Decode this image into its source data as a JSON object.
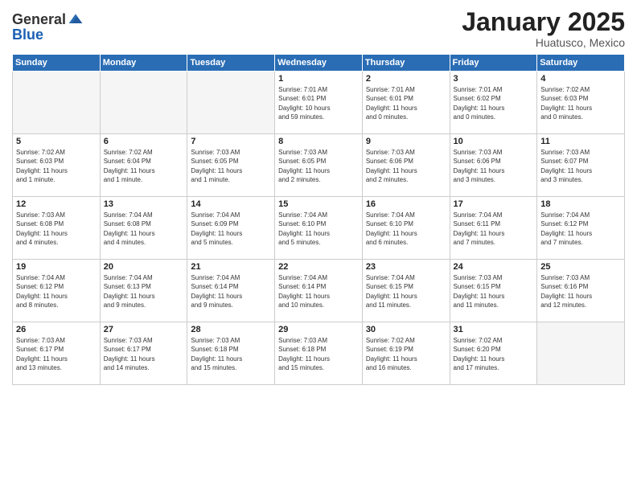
{
  "header": {
    "logo_general": "General",
    "logo_blue": "Blue",
    "title": "January 2025",
    "location": "Huatusco, Mexico"
  },
  "days_of_week": [
    "Sunday",
    "Monday",
    "Tuesday",
    "Wednesday",
    "Thursday",
    "Friday",
    "Saturday"
  ],
  "weeks": [
    [
      {
        "day": "",
        "info": ""
      },
      {
        "day": "",
        "info": ""
      },
      {
        "day": "",
        "info": ""
      },
      {
        "day": "1",
        "info": "Sunrise: 7:01 AM\nSunset: 6:01 PM\nDaylight: 10 hours\nand 59 minutes."
      },
      {
        "day": "2",
        "info": "Sunrise: 7:01 AM\nSunset: 6:01 PM\nDaylight: 11 hours\nand 0 minutes."
      },
      {
        "day": "3",
        "info": "Sunrise: 7:01 AM\nSunset: 6:02 PM\nDaylight: 11 hours\nand 0 minutes."
      },
      {
        "day": "4",
        "info": "Sunrise: 7:02 AM\nSunset: 6:03 PM\nDaylight: 11 hours\nand 0 minutes."
      }
    ],
    [
      {
        "day": "5",
        "info": "Sunrise: 7:02 AM\nSunset: 6:03 PM\nDaylight: 11 hours\nand 1 minute."
      },
      {
        "day": "6",
        "info": "Sunrise: 7:02 AM\nSunset: 6:04 PM\nDaylight: 11 hours\nand 1 minute."
      },
      {
        "day": "7",
        "info": "Sunrise: 7:03 AM\nSunset: 6:05 PM\nDaylight: 11 hours\nand 1 minute."
      },
      {
        "day": "8",
        "info": "Sunrise: 7:03 AM\nSunset: 6:05 PM\nDaylight: 11 hours\nand 2 minutes."
      },
      {
        "day": "9",
        "info": "Sunrise: 7:03 AM\nSunset: 6:06 PM\nDaylight: 11 hours\nand 2 minutes."
      },
      {
        "day": "10",
        "info": "Sunrise: 7:03 AM\nSunset: 6:06 PM\nDaylight: 11 hours\nand 3 minutes."
      },
      {
        "day": "11",
        "info": "Sunrise: 7:03 AM\nSunset: 6:07 PM\nDaylight: 11 hours\nand 3 minutes."
      }
    ],
    [
      {
        "day": "12",
        "info": "Sunrise: 7:03 AM\nSunset: 6:08 PM\nDaylight: 11 hours\nand 4 minutes."
      },
      {
        "day": "13",
        "info": "Sunrise: 7:04 AM\nSunset: 6:08 PM\nDaylight: 11 hours\nand 4 minutes."
      },
      {
        "day": "14",
        "info": "Sunrise: 7:04 AM\nSunset: 6:09 PM\nDaylight: 11 hours\nand 5 minutes."
      },
      {
        "day": "15",
        "info": "Sunrise: 7:04 AM\nSunset: 6:10 PM\nDaylight: 11 hours\nand 5 minutes."
      },
      {
        "day": "16",
        "info": "Sunrise: 7:04 AM\nSunset: 6:10 PM\nDaylight: 11 hours\nand 6 minutes."
      },
      {
        "day": "17",
        "info": "Sunrise: 7:04 AM\nSunset: 6:11 PM\nDaylight: 11 hours\nand 7 minutes."
      },
      {
        "day": "18",
        "info": "Sunrise: 7:04 AM\nSunset: 6:12 PM\nDaylight: 11 hours\nand 7 minutes."
      }
    ],
    [
      {
        "day": "19",
        "info": "Sunrise: 7:04 AM\nSunset: 6:12 PM\nDaylight: 11 hours\nand 8 minutes."
      },
      {
        "day": "20",
        "info": "Sunrise: 7:04 AM\nSunset: 6:13 PM\nDaylight: 11 hours\nand 9 minutes."
      },
      {
        "day": "21",
        "info": "Sunrise: 7:04 AM\nSunset: 6:14 PM\nDaylight: 11 hours\nand 9 minutes."
      },
      {
        "day": "22",
        "info": "Sunrise: 7:04 AM\nSunset: 6:14 PM\nDaylight: 11 hours\nand 10 minutes."
      },
      {
        "day": "23",
        "info": "Sunrise: 7:04 AM\nSunset: 6:15 PM\nDaylight: 11 hours\nand 11 minutes."
      },
      {
        "day": "24",
        "info": "Sunrise: 7:03 AM\nSunset: 6:15 PM\nDaylight: 11 hours\nand 11 minutes."
      },
      {
        "day": "25",
        "info": "Sunrise: 7:03 AM\nSunset: 6:16 PM\nDaylight: 11 hours\nand 12 minutes."
      }
    ],
    [
      {
        "day": "26",
        "info": "Sunrise: 7:03 AM\nSunset: 6:17 PM\nDaylight: 11 hours\nand 13 minutes."
      },
      {
        "day": "27",
        "info": "Sunrise: 7:03 AM\nSunset: 6:17 PM\nDaylight: 11 hours\nand 14 minutes."
      },
      {
        "day": "28",
        "info": "Sunrise: 7:03 AM\nSunset: 6:18 PM\nDaylight: 11 hours\nand 15 minutes."
      },
      {
        "day": "29",
        "info": "Sunrise: 7:03 AM\nSunset: 6:18 PM\nDaylight: 11 hours\nand 15 minutes."
      },
      {
        "day": "30",
        "info": "Sunrise: 7:02 AM\nSunset: 6:19 PM\nDaylight: 11 hours\nand 16 minutes."
      },
      {
        "day": "31",
        "info": "Sunrise: 7:02 AM\nSunset: 6:20 PM\nDaylight: 11 hours\nand 17 minutes."
      },
      {
        "day": "",
        "info": ""
      }
    ]
  ]
}
